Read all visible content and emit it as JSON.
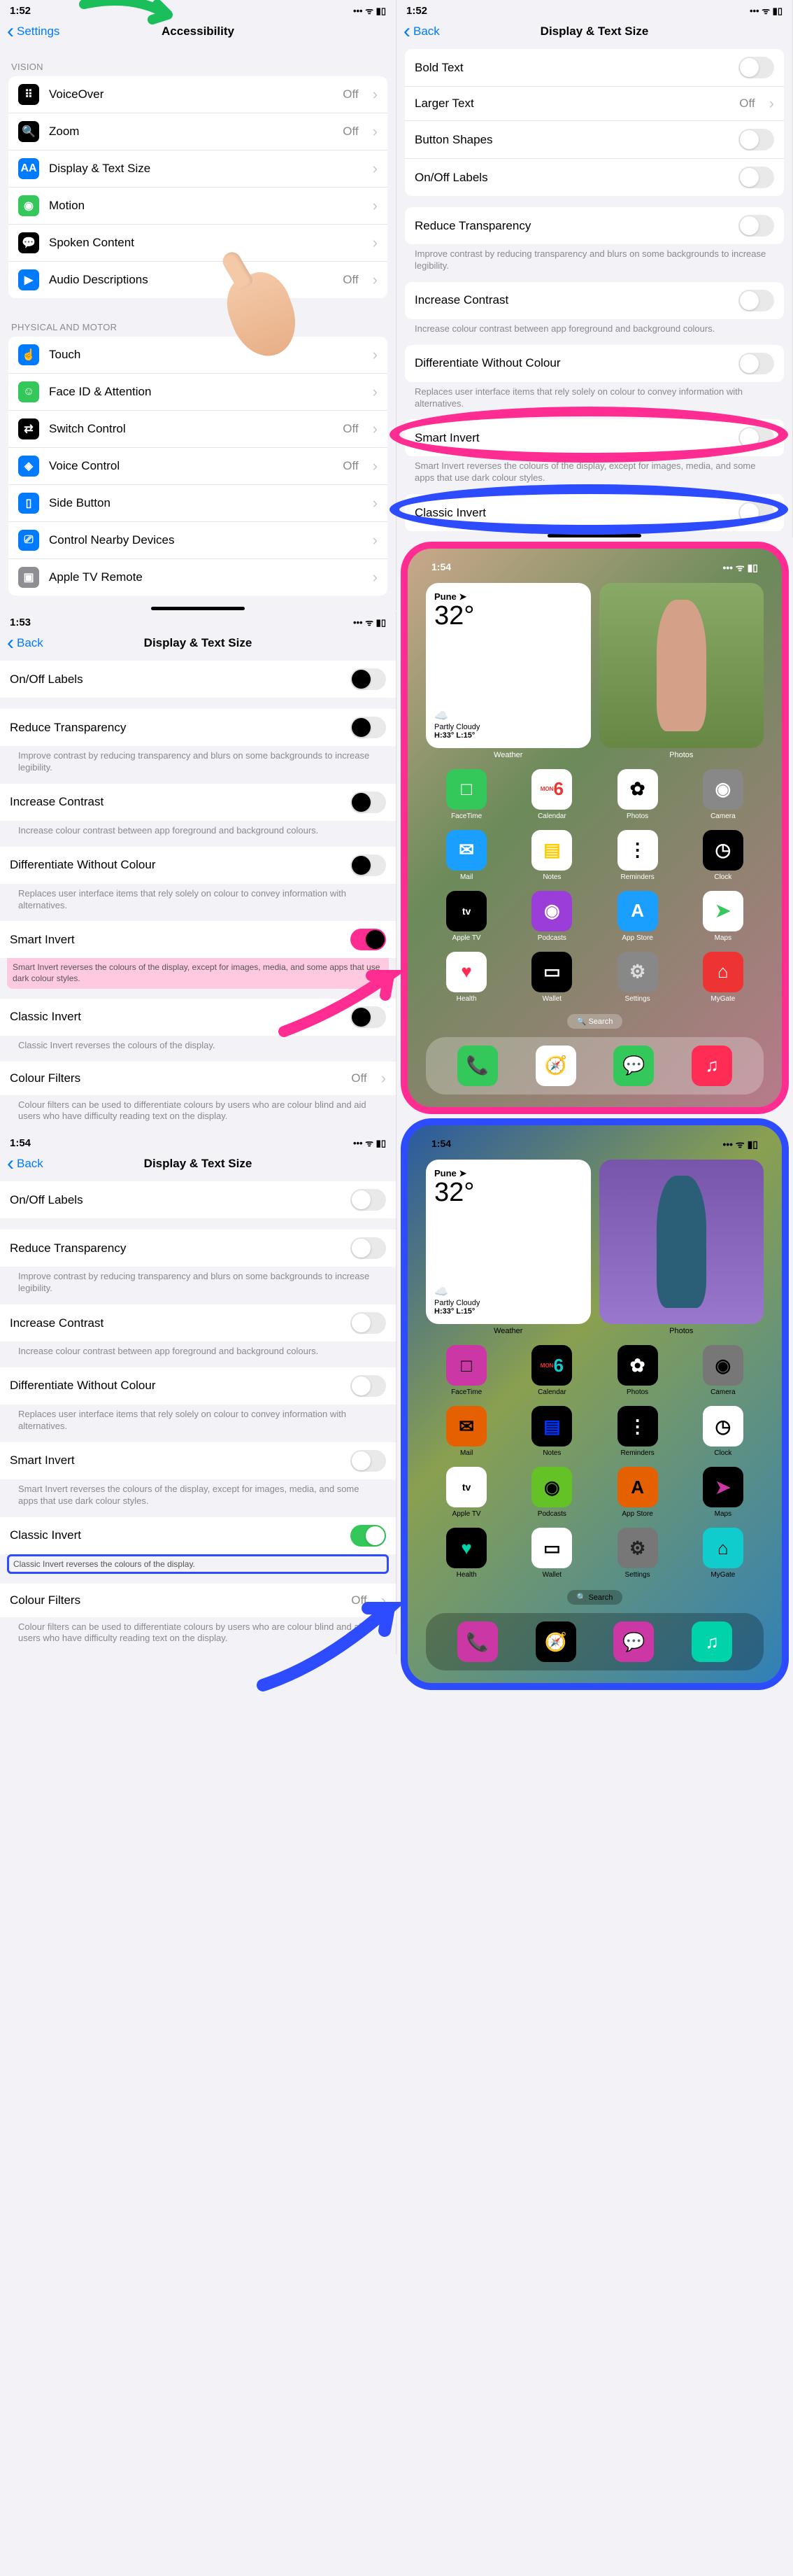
{
  "screens": {
    "accessibility": {
      "time": "1:52",
      "back": "Settings",
      "title": "Accessibility",
      "sections": {
        "vision": {
          "header": "VISION",
          "rows": [
            {
              "label": "VoiceOver",
              "value": "Off",
              "icon": "vo"
            },
            {
              "label": "Zoom",
              "value": "Off",
              "icon": "zoom"
            },
            {
              "label": "Display & Text Size",
              "value": "",
              "icon": "aa"
            },
            {
              "label": "Motion",
              "value": "",
              "icon": "motion"
            },
            {
              "label": "Spoken Content",
              "value": "",
              "icon": "speak"
            },
            {
              "label": "Audio Descriptions",
              "value": "Off",
              "icon": "ad"
            }
          ]
        },
        "physical": {
          "header": "PHYSICAL AND MOTOR",
          "rows": [
            {
              "label": "Touch",
              "value": "",
              "icon": "touch"
            },
            {
              "label": "Face ID & Attention",
              "value": "",
              "icon": "face"
            },
            {
              "label": "Switch Control",
              "value": "Off",
              "icon": "switch"
            },
            {
              "label": "Voice Control",
              "value": "Off",
              "icon": "voice"
            },
            {
              "label": "Side Button",
              "value": "",
              "icon": "side"
            },
            {
              "label": "Control Nearby Devices",
              "value": "",
              "icon": "nearby"
            },
            {
              "label": "Apple TV Remote",
              "value": "",
              "icon": "tv"
            }
          ]
        }
      }
    },
    "display1": {
      "time": "1:52",
      "back": "Back",
      "title": "Display & Text Size",
      "rows": [
        {
          "label": "Bold Text",
          "toggle": false
        },
        {
          "label": "Larger Text",
          "value": "Off"
        },
        {
          "label": "Button Shapes",
          "toggle": false
        },
        {
          "label": "On/Off Labels",
          "toggle": false
        },
        {
          "label": "Reduce Transparency",
          "toggle": false
        }
      ],
      "foot1": "Improve contrast by reducing transparency and blurs on some backgrounds to increase legibility.",
      "row_ic": {
        "label": "Increase Contrast",
        "toggle": false
      },
      "foot2": "Increase colour contrast between app foreground and background colours.",
      "row_dwc": {
        "label": "Differentiate Without Colour",
        "toggle": false
      },
      "foot3": "Replaces user interface items that rely solely on colour to convey information with alternatives.",
      "row_si": {
        "label": "Smart Invert",
        "toggle": false
      },
      "foot4": "Smart Invert reverses the colours of the display, except for images, media, and some apps that use dark colour styles.",
      "row_ci": {
        "label": "Classic Invert"
      }
    },
    "display2": {
      "time": "1:53",
      "back": "Back",
      "title": "Display & Text Size",
      "row_onoff": {
        "label": "On/Off Labels",
        "toggle": false
      },
      "row_rt": {
        "label": "Reduce Transparency",
        "toggle": false
      },
      "foot1": "Improve contrast by reducing transparency and blurs on some backgrounds to increase legibility.",
      "row_ic": {
        "label": "Increase Contrast",
        "toggle": false
      },
      "foot2": "Increase colour contrast between app foreground and background colours.",
      "row_dwc": {
        "label": "Differentiate Without Colour",
        "toggle": false
      },
      "foot3": "Replaces user interface items that rely solely on colour to convey information with alternatives.",
      "row_si": {
        "label": "Smart Invert",
        "toggle": true
      },
      "foot4": "Smart Invert reverses the colours of the display, except for images, media, and some apps that use dark colour styles.",
      "row_ci": {
        "label": "Classic Invert",
        "toggle": false
      },
      "foot5": "Classic Invert reverses the colours of the display.",
      "row_cf": {
        "label": "Colour Filters",
        "value": "Off"
      },
      "foot6": "Colour filters can be used to differentiate colours by users who are colour blind and aid users who have difficulty reading text on the display."
    },
    "display3": {
      "time": "1:54",
      "back": "Back",
      "title": "Display & Text Size",
      "row_onoff": {
        "label": "On/Off Labels",
        "toggle": false
      },
      "row_rt": {
        "label": "Reduce Transparency",
        "toggle": false
      },
      "foot1": "Improve contrast by reducing transparency and blurs on some backgrounds to increase legibility.",
      "row_ic": {
        "label": "Increase Contrast",
        "toggle": false
      },
      "foot2": "Increase colour contrast between app foreground and background colours.",
      "row_dwc": {
        "label": "Differentiate Without Colour",
        "toggle": false
      },
      "foot3": "Replaces user interface items that rely solely on colour to convey information with alternatives.",
      "row_si": {
        "label": "Smart Invert",
        "toggle": false
      },
      "foot4": "Smart Invert reverses the colours of the display, except for images, media, and some apps that use dark colour styles.",
      "row_ci": {
        "label": "Classic Invert",
        "toggle": true
      },
      "foot5": "Classic Invert reverses the colours of the display.",
      "row_cf": {
        "label": "Colour Filters",
        "value": "Off"
      },
      "foot6": "Colour filters can be used to differentiate colours by users who are colour blind and aid users who have difficulty reading text on the display."
    }
  },
  "home": {
    "time": "1:54",
    "weather": {
      "city": "Pune",
      "temp": "32°",
      "icon": "☁️",
      "cond": "Partly Cloudy",
      "hilo": "H:33° L:15°"
    },
    "wlabels": {
      "weather": "Weather",
      "photos": "Photos"
    },
    "apps": [
      {
        "name": "FaceTime",
        "bg": "#34c759",
        "fg": "#fff",
        "glyph": "□"
      },
      {
        "name": "Calendar",
        "bg": "#fff",
        "fg": "#e33",
        "glyph": "6",
        "sub": "MON"
      },
      {
        "name": "Photos",
        "bg": "#fff",
        "fg": "#000",
        "glyph": "✿"
      },
      {
        "name": "Camera",
        "bg": "#888",
        "fg": "#fff",
        "glyph": "◉"
      },
      {
        "name": "Mail",
        "bg": "#1a9fff",
        "fg": "#fff",
        "glyph": "✉"
      },
      {
        "name": "Notes",
        "bg": "#fff",
        "fg": "#ffcc00",
        "glyph": "▤"
      },
      {
        "name": "Reminders",
        "bg": "#fff",
        "fg": "#000",
        "glyph": "⋮"
      },
      {
        "name": "Clock",
        "bg": "#000",
        "fg": "#fff",
        "glyph": "◷"
      },
      {
        "name": "Apple TV",
        "bg": "#000",
        "fg": "#fff",
        "glyph": "tv"
      },
      {
        "name": "Podcasts",
        "bg": "#9b3dd9",
        "fg": "#fff",
        "glyph": "◉"
      },
      {
        "name": "App Store",
        "bg": "#1a9fff",
        "fg": "#fff",
        "glyph": "A"
      },
      {
        "name": "Maps",
        "bg": "#fff",
        "fg": "#34c759",
        "glyph": "➤"
      },
      {
        "name": "Health",
        "bg": "#fff",
        "fg": "#ff2d55",
        "glyph": "♥"
      },
      {
        "name": "Wallet",
        "bg": "#000",
        "fg": "#fff",
        "glyph": "▭"
      },
      {
        "name": "Settings",
        "bg": "#888",
        "fg": "#ddd",
        "glyph": "⚙"
      },
      {
        "name": "MyGate",
        "bg": "#e33",
        "fg": "#fff",
        "glyph": "⌂"
      }
    ],
    "apps_invert": [
      {
        "name": "FaceTime",
        "bg": "#cb38a6",
        "fg": "#000",
        "glyph": "□"
      },
      {
        "name": "Calendar",
        "bg": "#000",
        "fg": "#1cc",
        "glyph": "6",
        "sub": "MON"
      },
      {
        "name": "Photos",
        "bg": "#000",
        "fg": "#fff",
        "glyph": "✿"
      },
      {
        "name": "Camera",
        "bg": "#777",
        "fg": "#000",
        "glyph": "◉"
      },
      {
        "name": "Mail",
        "bg": "#e56000",
        "fg": "#000",
        "glyph": "✉"
      },
      {
        "name": "Notes",
        "bg": "#000",
        "fg": "#0033ff",
        "glyph": "▤"
      },
      {
        "name": "Reminders",
        "bg": "#000",
        "fg": "#fff",
        "glyph": "⋮"
      },
      {
        "name": "Clock",
        "bg": "#fff",
        "fg": "#000",
        "glyph": "◷"
      },
      {
        "name": "Apple TV",
        "bg": "#fff",
        "fg": "#000",
        "glyph": "tv"
      },
      {
        "name": "Podcasts",
        "bg": "#64c226",
        "fg": "#000",
        "glyph": "◉"
      },
      {
        "name": "App Store",
        "bg": "#e56000",
        "fg": "#000",
        "glyph": "A"
      },
      {
        "name": "Maps",
        "bg": "#000",
        "fg": "#cb38a6",
        "glyph": "➤"
      },
      {
        "name": "Health",
        "bg": "#000",
        "fg": "#00d2aa",
        "glyph": "♥"
      },
      {
        "name": "Wallet",
        "bg": "#fff",
        "fg": "#000",
        "glyph": "▭"
      },
      {
        "name": "Settings",
        "bg": "#777",
        "fg": "#222",
        "glyph": "⚙"
      },
      {
        "name": "MyGate",
        "bg": "#1cc",
        "fg": "#000",
        "glyph": "⌂"
      }
    ],
    "search": "Search",
    "dock": [
      {
        "bg": "#34c759",
        "glyph": "📞"
      },
      {
        "bg": "#fff",
        "glyph": "🧭"
      },
      {
        "bg": "#34c759",
        "glyph": "💬"
      },
      {
        "bg": "#ff2d55",
        "glyph": "♫"
      }
    ],
    "dock_invert": [
      {
        "bg": "#cb38a6",
        "glyph": "📞"
      },
      {
        "bg": "#000",
        "glyph": "🧭"
      },
      {
        "bg": "#cb38a6",
        "glyph": "💬"
      },
      {
        "bg": "#00d2aa",
        "glyph": "♫"
      }
    ]
  },
  "status_icons": "📶 📡 🔋"
}
